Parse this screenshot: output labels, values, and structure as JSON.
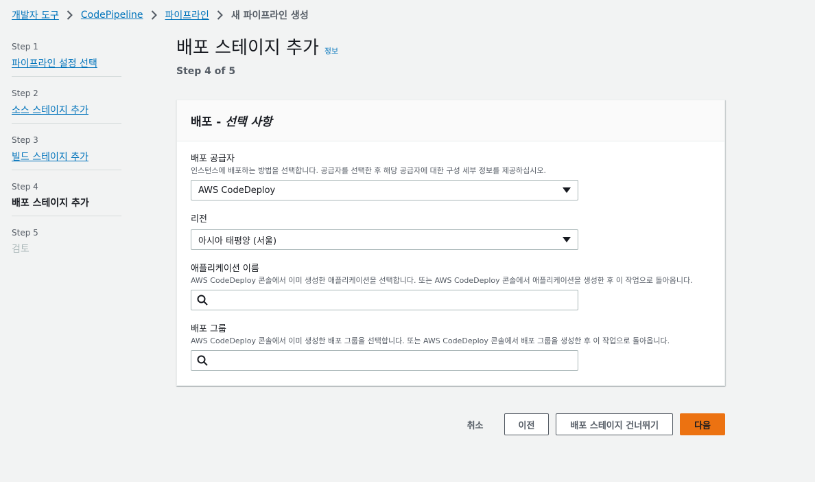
{
  "breadcrumb": {
    "items": [
      "개발자 도구",
      "CodePipeline",
      "파이프라인"
    ],
    "current": "새 파이프라인 생성"
  },
  "steps": [
    {
      "num": "Step 1",
      "label": "파이프라인 설정 선택",
      "state": "link"
    },
    {
      "num": "Step 2",
      "label": "소스 스테이지 추가",
      "state": "link"
    },
    {
      "num": "Step 3",
      "label": "빌드 스테이지 추가",
      "state": "link"
    },
    {
      "num": "Step 4",
      "label": "배포 스테이지 추가",
      "state": "current"
    },
    {
      "num": "Step 5",
      "label": "검토",
      "state": "disabled"
    }
  ],
  "header": {
    "title": "배포 스테이지 추가",
    "info": "정보",
    "step_of": "Step 4 of 5"
  },
  "panel": {
    "title_main": "배포 - ",
    "title_italic": "선택 사항"
  },
  "fields": {
    "provider": {
      "label": "배포 공급자",
      "desc": "인스턴스에 배포하는 방법을 선택합니다. 공급자를 선택한 후 해당 공급자에 대한 구성 세부 정보를 제공하십시오.",
      "value": "AWS CodeDeploy"
    },
    "region": {
      "label": "리전",
      "value": "아시아 태평양 (서울)"
    },
    "application": {
      "label": "애플리케이션 이름",
      "desc": "AWS CodeDeploy 콘솔에서 이미 생성한 애플리케이션을 선택합니다. 또는 AWS CodeDeploy 콘솔에서 애플리케이션을 생성한 후 이 작업으로 돌아옵니다.",
      "value": ""
    },
    "group": {
      "label": "배포 그룹",
      "desc": "AWS CodeDeploy 콘솔에서 이미 생성한 배포 그룹을 선택합니다. 또는 AWS CodeDeploy 콘솔에서 배포 그룹을 생성한 후 이 작업으로 돌아옵니다.",
      "value": ""
    }
  },
  "actions": {
    "cancel": "취소",
    "previous": "이전",
    "skip": "배포 스테이지 건너뛰기",
    "next": "다음"
  },
  "colors": {
    "link": "#0073bb",
    "primary": "#ec7211",
    "background": "#f2f3f3"
  }
}
